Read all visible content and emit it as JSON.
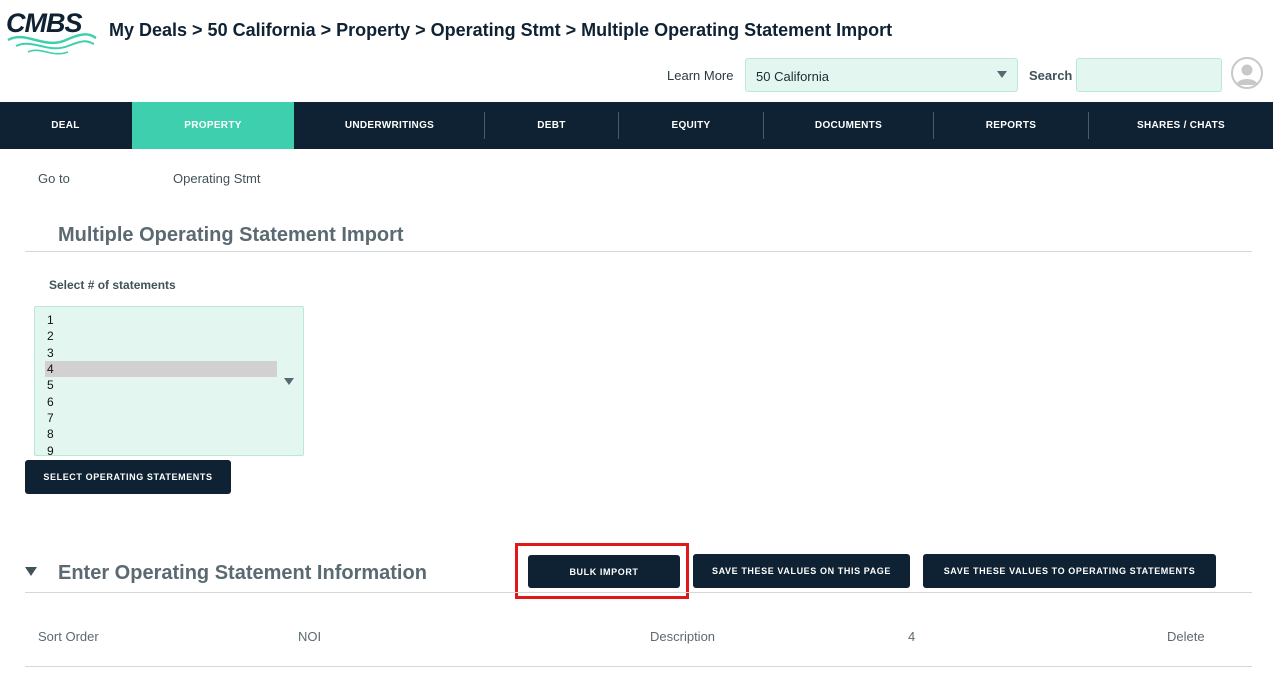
{
  "header": {
    "logo_text": "CMBS",
    "breadcrumb": "My Deals > 50 California > Property > Operating Stmt > Multiple Operating Statement Import",
    "learn_more": "Learn More",
    "deal_select_value": "50 California",
    "search_label": "Search",
    "search_value": ""
  },
  "nav": {
    "items": [
      {
        "label": "DEAL"
      },
      {
        "label": "PROPERTY",
        "active": true
      },
      {
        "label": "UNDERWRITINGS"
      },
      {
        "label": "DEBT"
      },
      {
        "label": "EQUITY"
      },
      {
        "label": "DOCUMENTS"
      },
      {
        "label": "REPORTS"
      },
      {
        "label": "SHARES / CHATS"
      }
    ]
  },
  "goto": {
    "label": "Go to",
    "value": "Operating Stmt"
  },
  "import_section": {
    "title": "Multiple Operating Statement Import",
    "select_label": "Select # of statements",
    "options": [
      "1",
      "2",
      "3",
      "4",
      "5",
      "6",
      "7",
      "8",
      "9"
    ],
    "selected": "4",
    "select_button": "SELECT OPERATING STATEMENTS"
  },
  "info_section": {
    "title": "Enter Operating Statement Information",
    "bulk_import": "BULK IMPORT",
    "save_page": "SAVE THESE VALUES ON THIS PAGE",
    "save_statements": "SAVE THESE VALUES TO OPERATING STATEMENTS",
    "columns": [
      "Sort Order",
      "NOI",
      "Description",
      "4",
      "Delete"
    ]
  },
  "colors": {
    "navy": "#0f2233",
    "accent": "#3ecfae",
    "input_bg": "#e3f7f0",
    "highlight": "#e01818"
  }
}
